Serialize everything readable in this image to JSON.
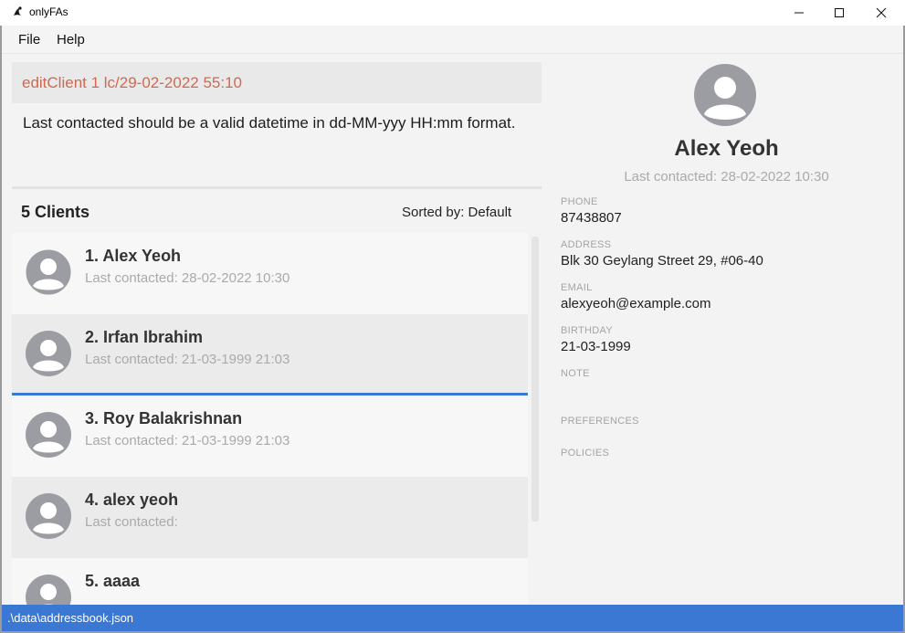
{
  "window": {
    "title": "onlyFAs",
    "icons": {
      "app": "app-logo-icon",
      "minimize": "minimize-icon",
      "maximize": "maximize-icon",
      "close": "close-icon"
    }
  },
  "menu": {
    "file": "File",
    "help": "Help"
  },
  "command": {
    "text": "editClient 1 lc/29-02-2022 55:10"
  },
  "result": {
    "text": "Last contacted should be a valid datetime in dd-MM-yyy HH:mm format."
  },
  "list": {
    "header": "5 Clients",
    "sort": "Sorted by: Default",
    "clients": [
      {
        "name": "1.  Alex Yeoh",
        "last": "Last contacted: 28-02-2022 10:30"
      },
      {
        "name": "2.  Irfan Ibrahim",
        "last": "Last contacted: 21-03-1999 21:03"
      },
      {
        "name": "3.  Roy Balakrishnan",
        "last": "Last contacted: 21-03-1999 21:03"
      },
      {
        "name": "4.  alex yeoh",
        "last": "Last contacted:"
      },
      {
        "name": "5.  aaaa",
        "last": ""
      }
    ]
  },
  "detail": {
    "name": "Alex Yeoh",
    "last": "Last contacted: 28-02-2022 10:30",
    "phone_label": "PHONE",
    "phone": "87438807",
    "address_label": "ADDRESS",
    "address": "Blk 30 Geylang Street 29, #06-40",
    "email_label": "EMAIL",
    "email": "alexyeoh@example.com",
    "birthday_label": "BIRTHDAY",
    "birthday": "21-03-1999",
    "note_label": "NOTE",
    "preferences_label": "PREFERENCES",
    "policies_label": "POLICIES"
  },
  "status": {
    "path": ".\\data\\addressbook.json"
  },
  "colors": {
    "accent": "#3a78d4",
    "command_text": "#d1684f",
    "muted_text": "#aaaaaa",
    "avatar": "#9b9da3"
  }
}
